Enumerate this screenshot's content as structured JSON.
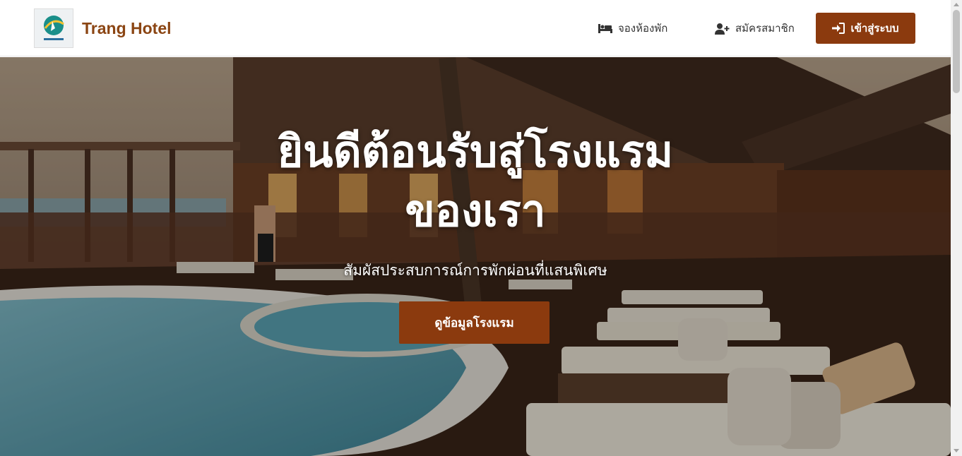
{
  "header": {
    "brand": "Trang Hotel",
    "logo_icon": "hotel-logo",
    "nav": [
      {
        "label": "จองห้องพัก",
        "icon": "bed-icon"
      },
      {
        "label": "สมัครสมาชิก",
        "icon": "user-plus-icon"
      }
    ],
    "login_label": "เข้าสู่ระบบ",
    "login_icon": "sign-in-icon"
  },
  "hero": {
    "title_line1": "ยินดีต้อนรับสู่โรงแรม",
    "title_line2": "ของเรา",
    "subtitle": "สัมผัสประสบการณ์การพักผ่อนที่แสนพิเศษ",
    "cta_label": "ดูข้อมูลโรงแรม",
    "background": "hotel-pool-deck-photo"
  },
  "colors": {
    "brand": "#8b4513",
    "button": "#8b3a0e",
    "text": "#333333"
  }
}
